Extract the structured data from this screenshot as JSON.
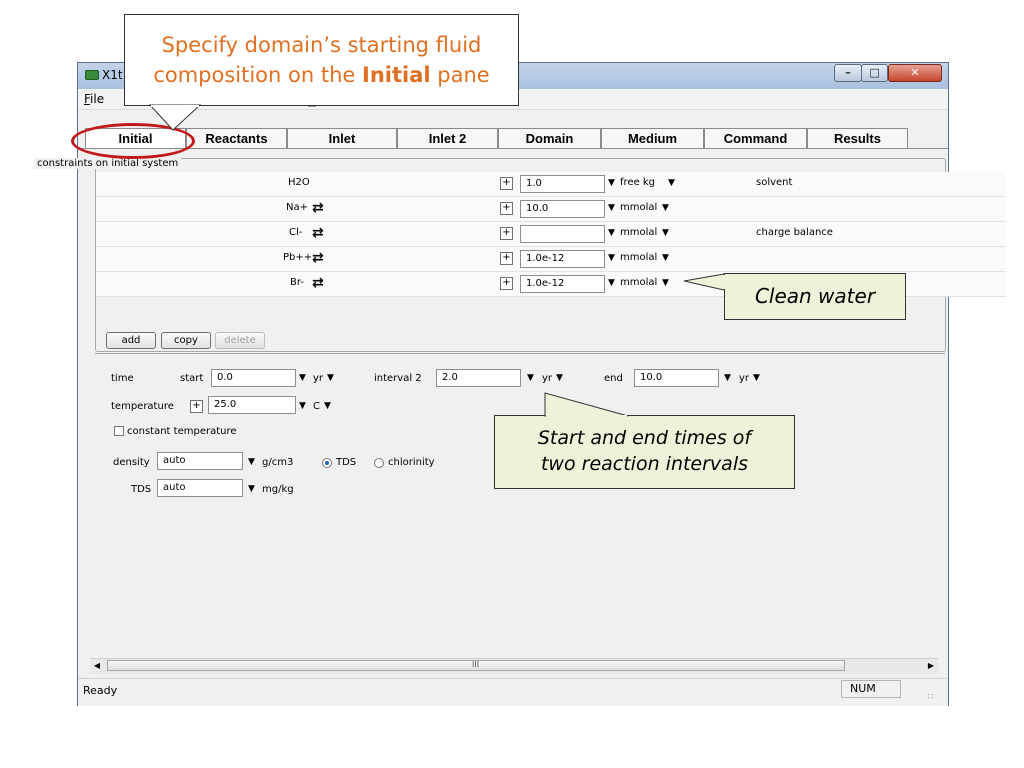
{
  "window": {
    "title": "X1t",
    "menu": {
      "file_label": "File",
      "file_mnemonic": "F",
      "file_rest": "ile"
    },
    "caption_buttons": [
      "minimize-icon",
      "maximize-icon",
      "close-icon"
    ]
  },
  "tabs": [
    {
      "label": "Initial",
      "active": true
    },
    {
      "label": "Reactants",
      "active": false
    },
    {
      "label": "Inlet",
      "active": false
    },
    {
      "label": "Inlet 2",
      "active": false
    },
    {
      "label": "Domain",
      "active": false
    },
    {
      "label": "Medium",
      "active": false
    },
    {
      "label": "Command",
      "active": false
    },
    {
      "label": "Results",
      "active": false
    }
  ],
  "constraints": {
    "legend": "constraints on initial system",
    "rows": [
      {
        "species": "H2O",
        "swap": false,
        "value": "1.0",
        "unit": "free kg",
        "unit_dropdown": true,
        "note": "solvent"
      },
      {
        "species": "Na+",
        "swap": true,
        "value": "10.0",
        "unit": "mmolal",
        "unit_dropdown": true,
        "note": ""
      },
      {
        "species": "Cl-",
        "swap": true,
        "value": "",
        "unit": "mmolal",
        "unit_dropdown": true,
        "note": "charge balance"
      },
      {
        "species": "Pb++",
        "swap": true,
        "value": "1.0e-12",
        "unit": "mmolal",
        "unit_dropdown": true,
        "note": ""
      },
      {
        "species": "Br-",
        "swap": true,
        "value": "1.0e-12",
        "unit": "mmolal",
        "unit_dropdown": true,
        "note": ""
      }
    ],
    "buttons": {
      "add": "add",
      "copy": "copy",
      "delete": "delete"
    }
  },
  "time": {
    "label": "time",
    "start_label": "start",
    "start_value": "0.0",
    "start_unit": "yr",
    "interval_label": "interval 2",
    "interval_value": "2.0",
    "interval_unit": "yr",
    "end_label": "end",
    "end_value": "10.0",
    "end_unit": "yr"
  },
  "temperature": {
    "label": "temperature",
    "value": "25.0",
    "unit": "C"
  },
  "constant_temperature": {
    "label": "constant temperature",
    "checked": false
  },
  "density": {
    "label": "density",
    "value": "auto",
    "unit": "g/cm3",
    "radio_tds": "TDS",
    "radio_chlorinity": "chlorinity",
    "selected": "TDS"
  },
  "tds": {
    "label": "TDS",
    "value": "auto",
    "unit": "mg/kg"
  },
  "scrollbar": {
    "grip": "III"
  },
  "status": {
    "ready": "Ready",
    "num": "NUM"
  },
  "callouts": {
    "top_line1": "Specify domain’s starting fluid",
    "top_line2_pre": "composition on the ",
    "top_line2_bold": "Initial",
    "top_line2_post": " pane",
    "clean": "Clean water",
    "times_line1": "Start and end times of",
    "times_line2": "two reaction intervals"
  },
  "colors": {
    "callout_text": "#e07021",
    "oval": "#c21a1a",
    "callout_fill": "#f0f1d9"
  }
}
